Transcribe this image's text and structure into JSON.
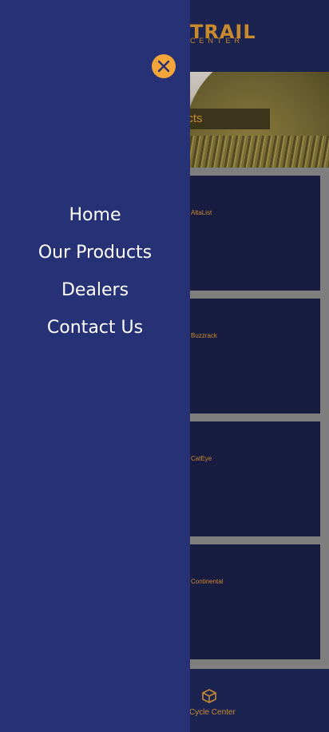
{
  "header": {
    "logo_big": "TRAIL",
    "logo_small": "CENTER"
  },
  "hero": {
    "button_label": "ucts"
  },
  "cards": [
    {
      "label": "AltaList"
    },
    {
      "label": "Buzzrack"
    },
    {
      "label": "CatEye"
    },
    {
      "label": "Continental"
    }
  ],
  "footer": {
    "text": "l Cycle Center",
    "icon": "box-icon"
  },
  "drawer": {
    "close_icon": "close-icon",
    "items": [
      {
        "label": "Home"
      },
      {
        "label": "Our Products"
      },
      {
        "label": "Dealers"
      },
      {
        "label": "Contact Us"
      }
    ]
  },
  "colors": {
    "drawer": "#273175",
    "accent": "#f3a63a",
    "brand": "#c98a2e"
  }
}
